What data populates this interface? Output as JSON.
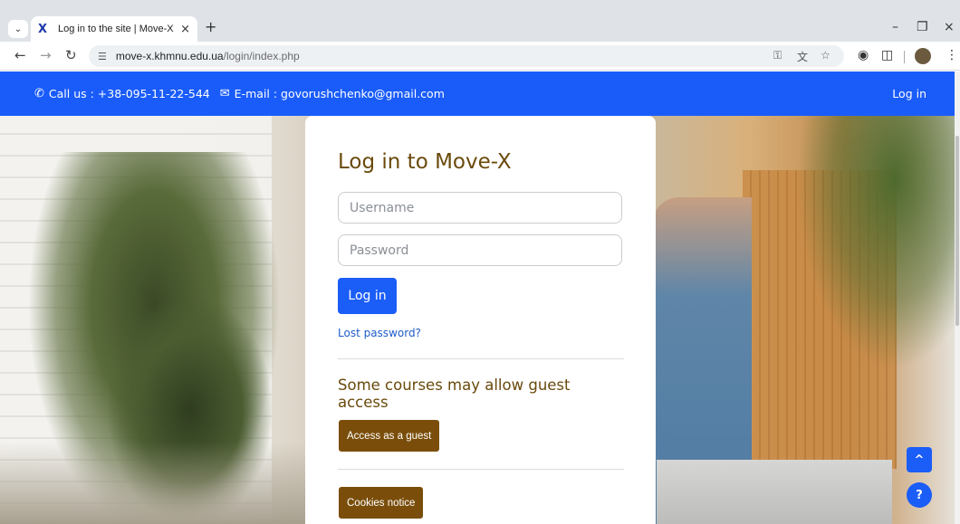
{
  "browser": {
    "tab_title": "Log in to the site | Move-X",
    "tab_favicon": "X",
    "new_tab": "+",
    "url_host": "move-x.khmnu.edu.ua",
    "url_path": "/login/index.php",
    "icons": {
      "tab_list": "chevron-down-icon",
      "back": "arrow-left-icon",
      "forward": "arrow-right-icon",
      "reload": "reload-icon",
      "site_info": "tune-icon",
      "password": "key-icon",
      "translate": "translate-icon",
      "bookmark": "star-icon",
      "extension": "puzzle-icon",
      "minimize": "minimize-icon",
      "restore": "restore-icon",
      "close": "close-icon",
      "menu": "kebab-menu-icon"
    }
  },
  "header": {
    "call": "Call us : +38-095-11-22-544",
    "email": "E-mail : govorushchenko@gmail.com",
    "login": "Log in",
    "background": "#1a5cfa"
  },
  "login": {
    "title": "Log in to Move-X",
    "username_placeholder": "Username",
    "password_placeholder": "Password",
    "submit": "Log in",
    "lost_password": "Lost password?",
    "guest_heading": "Some courses may allow guest access",
    "guest_button": "Access as a guest",
    "cookies_button": "Cookies notice"
  },
  "colors": {
    "primary": "#1b5df7",
    "brand_brown": "#7a4e0a",
    "title_brown": "#6a4a0c"
  },
  "fabs": {
    "up": "^",
    "help": "?"
  }
}
